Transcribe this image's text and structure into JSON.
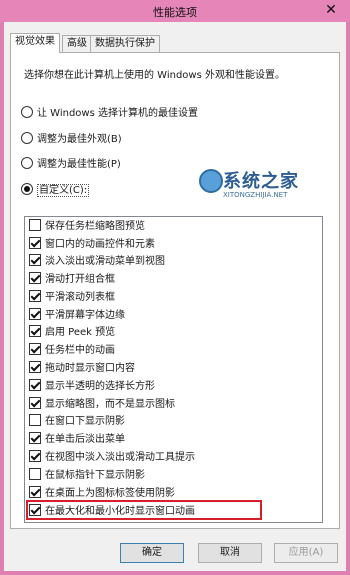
{
  "window": {
    "title": "性能选项",
    "close_glyph": "✕"
  },
  "tabs": [
    {
      "label": "视觉效果"
    },
    {
      "label": "高级"
    },
    {
      "label": "数据执行保护"
    }
  ],
  "description": "选择你想在此计算机上使用的 Windows 外观和性能设置。",
  "radios": [
    {
      "label": "让 Windows 选择计算机的最佳设置",
      "selected": false
    },
    {
      "label": "调整为最佳外观(B)",
      "selected": false
    },
    {
      "label": "调整为最佳性能(P)",
      "selected": false
    },
    {
      "label": "自定义(C):",
      "selected": true
    }
  ],
  "effects": [
    {
      "label": "保存任务栏缩略图预览",
      "checked": false
    },
    {
      "label": "窗口内的动画控件和元素",
      "checked": true
    },
    {
      "label": "淡入淡出或滑动菜单到视图",
      "checked": true
    },
    {
      "label": "滑动打开组合框",
      "checked": true
    },
    {
      "label": "平滑滚动列表框",
      "checked": true
    },
    {
      "label": "平滑屏幕字体边缘",
      "checked": true
    },
    {
      "label": "启用 Peek 预览",
      "checked": true
    },
    {
      "label": "任务栏中的动画",
      "checked": true
    },
    {
      "label": "拖动时显示窗口内容",
      "checked": true
    },
    {
      "label": "显示半透明的选择长方形",
      "checked": true
    },
    {
      "label": "显示缩略图，而不是显示图标",
      "checked": true
    },
    {
      "label": "在窗口下显示阴影",
      "checked": false
    },
    {
      "label": "在单击后淡出菜单",
      "checked": true
    },
    {
      "label": "在视图中淡入淡出或滑动工具提示",
      "checked": true
    },
    {
      "label": "在鼠标指针下显示阴影",
      "checked": false
    },
    {
      "label": "在桌面上为图标标签使用阴影",
      "checked": true
    },
    {
      "label": "在最大化和最小化时显示窗口动画",
      "checked": true
    }
  ],
  "buttons": {
    "ok": "确定",
    "cancel": "取消",
    "apply": "应用(A)"
  },
  "watermark": {
    "brand": "系统之家",
    "url": "XITONGZHIJIA.NET"
  },
  "colors": {
    "frame": "#e07fb2",
    "highlight": "#d61f2b"
  }
}
